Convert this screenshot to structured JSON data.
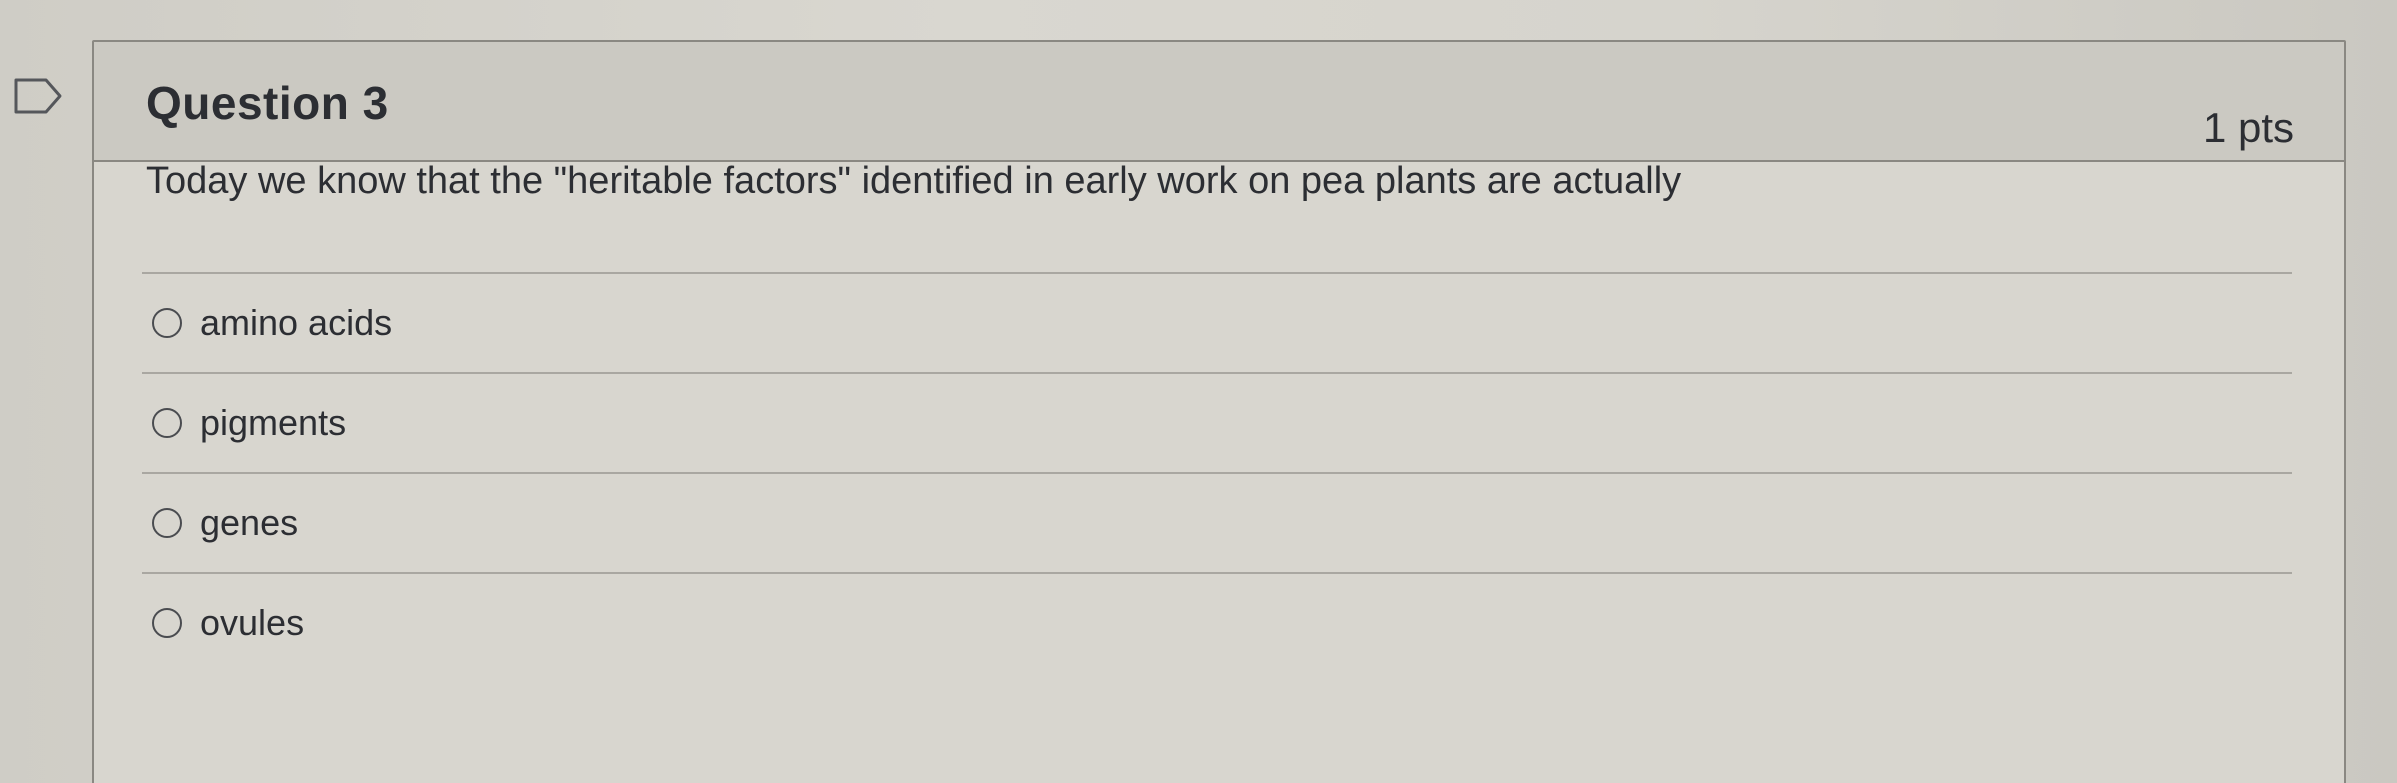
{
  "question": {
    "title": "Question 3",
    "points": "1 pts",
    "text": "Today we know that the \"heritable factors\" identified in early work on pea plants are actually"
  },
  "answers": [
    {
      "label": "amino acids"
    },
    {
      "label": "pigments"
    },
    {
      "label": "genes"
    },
    {
      "label": "ovules"
    }
  ],
  "icons": {
    "flag": "flag-icon",
    "radio": "radio-button-icon"
  },
  "colors": {
    "text": "#2c2e33",
    "header_bg": "#cbc9c2",
    "border": "#8a8882"
  }
}
